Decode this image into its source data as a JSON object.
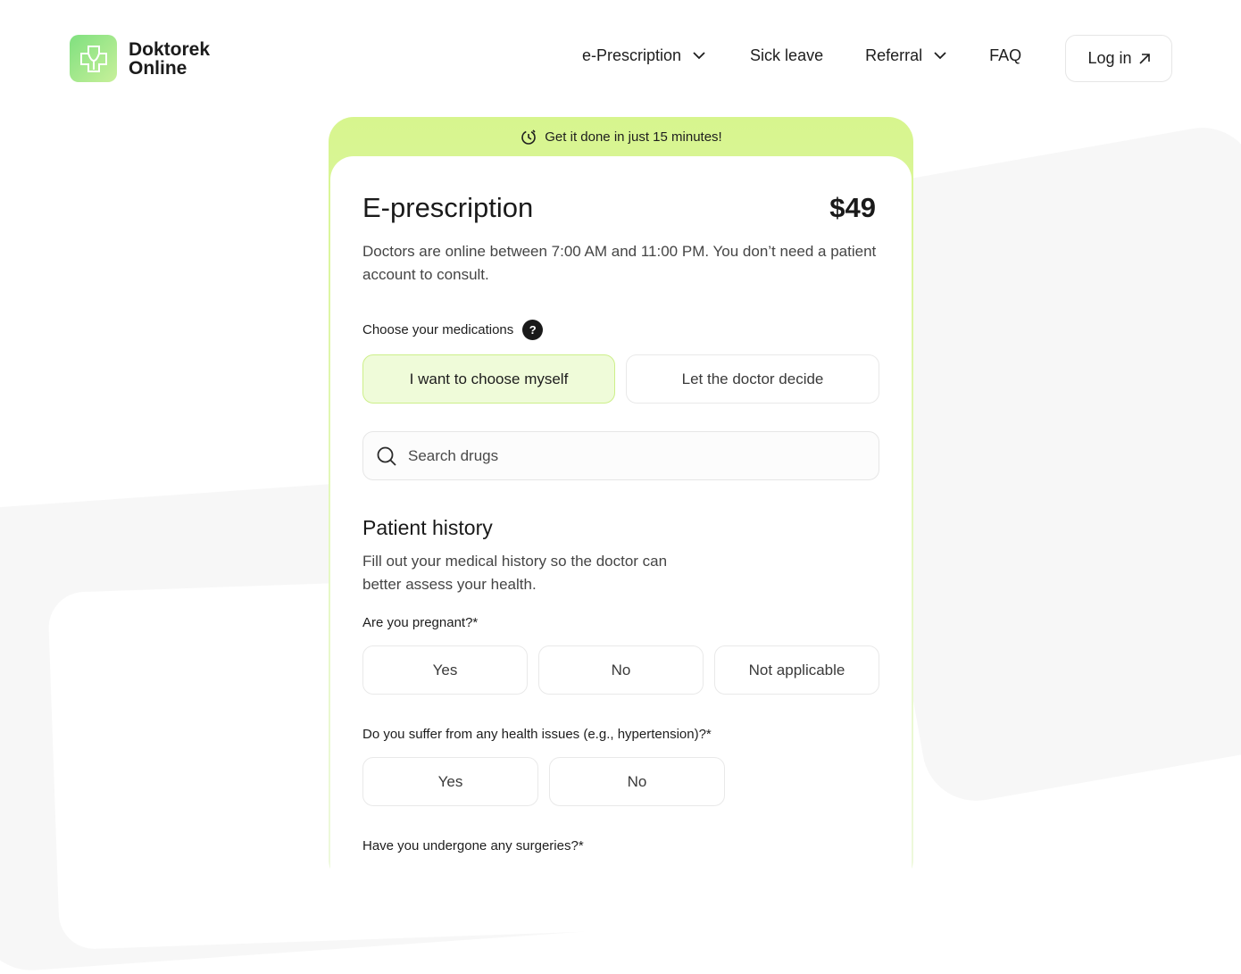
{
  "brand": {
    "name_line1": "Doktorek",
    "name_line2": "Online",
    "accent": "#8fe07f"
  },
  "nav": {
    "items": [
      {
        "label": "e-Prescription",
        "has_dropdown": true
      },
      {
        "label": "Sick leave",
        "has_dropdown": false
      },
      {
        "label": "Referral",
        "has_dropdown": true
      },
      {
        "label": "FAQ",
        "has_dropdown": false
      }
    ],
    "login_label": "Log in"
  },
  "banner": {
    "text": "Get it done in just 15 minutes!"
  },
  "card": {
    "title": "E-prescription",
    "price": "$49",
    "description": "Doctors are online between 7:00 AM and 11:00 PM. You don’t need a patient account to consult.",
    "medications": {
      "label": "Choose your medications",
      "options": [
        "I want to choose myself",
        "Let the doctor decide"
      ],
      "selected": "I want to choose myself"
    },
    "search": {
      "placeholder": "Search drugs",
      "value": ""
    },
    "history": {
      "title": "Patient history",
      "description": "Fill out your medical history so the doctor can better assess your health.",
      "questions": [
        {
          "label": "Are you pregnant?*",
          "options": [
            "Yes",
            "No",
            "Not applicable"
          ]
        },
        {
          "label": "Do you suffer from any health issues (e.g., hypertension)?*",
          "options": [
            "Yes",
            "No"
          ]
        },
        {
          "label": "Have you undergone any surgeries?*"
        }
      ]
    }
  }
}
